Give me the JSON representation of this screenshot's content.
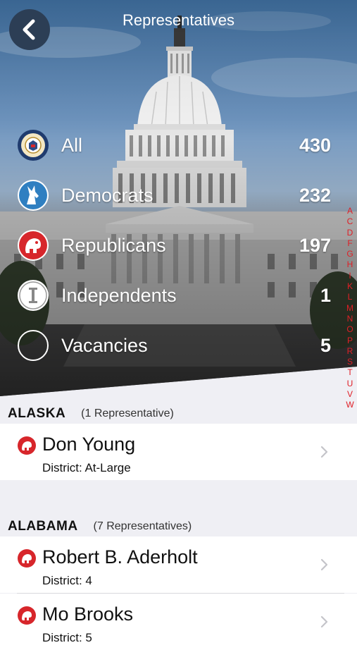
{
  "header": {
    "title": "Representatives",
    "back_icon": "chevron-left-icon"
  },
  "categories": [
    {
      "label": "All",
      "count": "430",
      "icon": "house-seal-icon"
    },
    {
      "label": "Democrats",
      "count": "232",
      "icon": "donkey-icon"
    },
    {
      "label": "Republicans",
      "count": "197",
      "icon": "elephant-icon"
    },
    {
      "label": "Independents",
      "count": "1",
      "icon": "independent-icon"
    },
    {
      "label": "Vacancies",
      "count": "5",
      "icon": "vacancy-circle-icon"
    }
  ],
  "index_letters": [
    "A",
    "C",
    "D",
    "F",
    "G",
    "H",
    "I",
    "K",
    "L",
    "M",
    "N",
    "O",
    "P",
    "R",
    "S",
    "T",
    "U",
    "V",
    "W"
  ],
  "sections": [
    {
      "state": "ALASKA",
      "count": "(1 Representative)",
      "members": [
        {
          "name": "Don Young",
          "district": "District: At-Large",
          "party": "republican"
        }
      ]
    },
    {
      "state": "ALABAMA",
      "count": "(7 Representatives)",
      "members": [
        {
          "name": "Robert B. Aderholt",
          "district": "District: 4",
          "party": "republican"
        },
        {
          "name": "Mo Brooks",
          "district": "District: 5",
          "party": "republican"
        }
      ]
    }
  ],
  "colors": {
    "accent": "#e01f26",
    "back_button": "#2c3e55",
    "democrat": "#2f7fc1",
    "republican": "#d7262b"
  }
}
